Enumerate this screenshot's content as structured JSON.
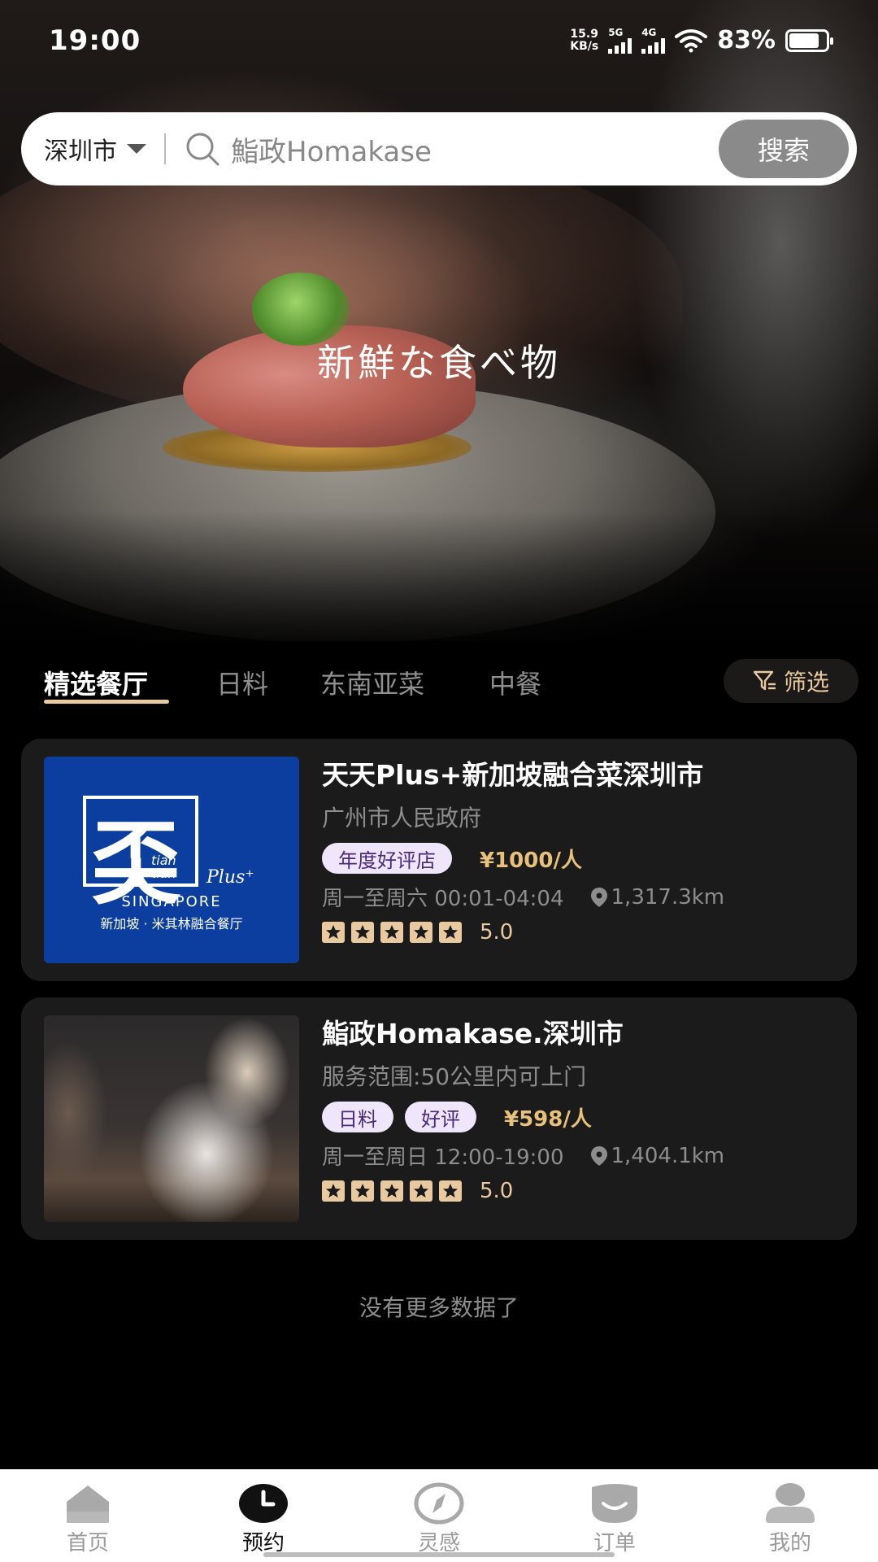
{
  "status_bar": {
    "time": "19:00",
    "net_speed_value": "15.9",
    "net_speed_unit": "KB/s",
    "signal_1_label": "5G",
    "signal_2_label": "4G",
    "battery_percent": "83%",
    "battery_level": 0.83
  },
  "search": {
    "city": "深圳市",
    "placeholder": "鮨政Homakase",
    "button_label": "搜索"
  },
  "hero": {
    "title": "新鮮な食べ物"
  },
  "tabs": {
    "items": [
      {
        "label": "精选餐厅",
        "active": true
      },
      {
        "label": "日料",
        "active": false
      },
      {
        "label": "东南亚菜",
        "active": false
      },
      {
        "label": "中餐",
        "active": false
      }
    ],
    "filter_label": "筛选"
  },
  "restaurants": [
    {
      "name": "天天Plus+新加坡融合菜深圳市",
      "subtitle": "广州市人民政府",
      "tags": [
        "年度好评店"
      ],
      "price": "¥1000/人",
      "hours": "周一至周六 00:01-04:04",
      "distance": "1,317.3km",
      "stars": 5,
      "rating": "5.0",
      "logo": {
        "glyph": "奀",
        "tian_1": "tian",
        "tian_2": "tian",
        "plus": "Plus⁺",
        "country": "SINGAPORE",
        "tagline": "新加坡 · 米其林融合餐厅"
      }
    },
    {
      "name": "鮨政Homakase.深圳市",
      "subtitle": "服务范围:50公里内可上门",
      "tags": [
        "日料",
        "好评"
      ],
      "price": "¥598/人",
      "hours": "周一至周日 12:00-19:00",
      "distance": "1,404.1km",
      "stars": 5,
      "rating": "5.0"
    }
  ],
  "list_footer": "没有更多数据了",
  "bottom_nav": [
    {
      "label": "首页",
      "icon": "home-icon",
      "active": false
    },
    {
      "label": "预约",
      "icon": "clock-icon",
      "active": true
    },
    {
      "label": "灵感",
      "icon": "compass-icon",
      "active": false
    },
    {
      "label": "订单",
      "icon": "order-icon",
      "active": false
    },
    {
      "label": "我的",
      "icon": "profile-icon",
      "active": false
    }
  ],
  "colors": {
    "accent": "#e8c9a0",
    "price": "#e7c07c",
    "tag_bg": "#efe6fb",
    "tag_text": "#4b2a7a",
    "card_bg": "#1b1b1b"
  }
}
